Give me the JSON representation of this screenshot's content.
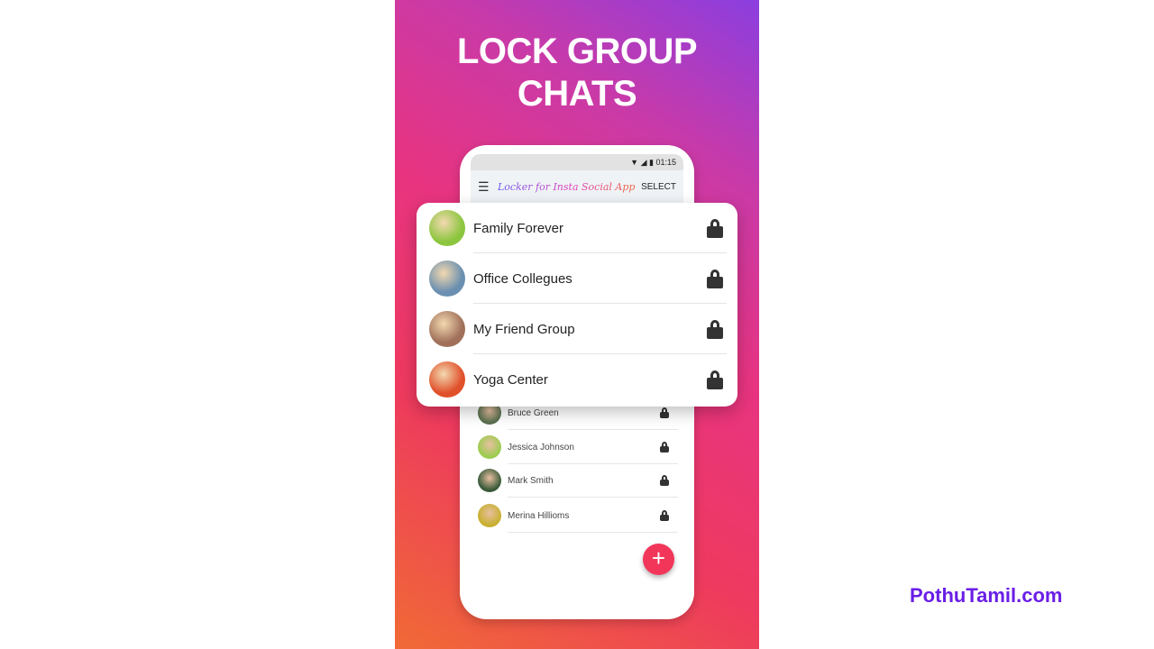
{
  "headline": [
    "LOCK GROUP",
    "CHATS"
  ],
  "status_bar": {
    "time": "01:15",
    "icons": [
      "wifi-icon",
      "signal-icon",
      "battery-icon"
    ]
  },
  "app_bar": {
    "title": "Locker for Insta Social App",
    "select_label": "SELECT",
    "menu_icon": "hamburger-menu-icon"
  },
  "groups": [
    {
      "name": "Family Forever",
      "locked": true,
      "avatar_color": "#8cc63f"
    },
    {
      "name": "Office Collegues",
      "locked": true,
      "avatar_color": "#6a8fb0"
    },
    {
      "name": "My Friend Group",
      "locked": true,
      "avatar_color": "#a0705a"
    },
    {
      "name": "Yoga Center",
      "locked": true,
      "avatar_color": "#e0502a"
    }
  ],
  "contacts": [
    {
      "name": "Bruce Green",
      "locked": true,
      "avatar_color": "#5a7050"
    },
    {
      "name": "Jessica Johnson",
      "locked": true,
      "avatar_color": "#9ccc50"
    },
    {
      "name": "Mark Smith",
      "locked": true,
      "avatar_color": "#3a5a3a"
    },
    {
      "name": "Merina Hillioms",
      "locked": true,
      "avatar_color": "#c8b030"
    }
  ],
  "fab": {
    "icon": "plus-icon",
    "label": "+"
  },
  "brand": "PothuTamil.com",
  "colors": {
    "accent": "#f2365a",
    "brand": "#6a1ee6"
  }
}
